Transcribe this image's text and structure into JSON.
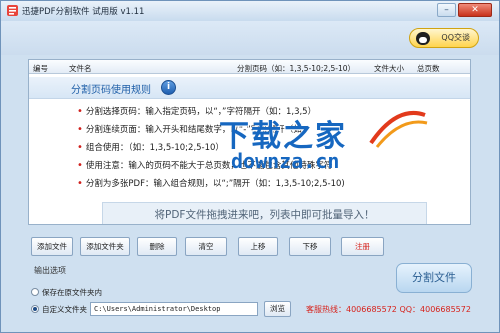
{
  "window": {
    "title": "迅捷PDF分割软件 试用版 v1.11",
    "min_glyph": "–",
    "close_glyph": "✕",
    "accent_color": "#1f5fa8"
  },
  "topbar": {
    "qq_label": "QQ交谈"
  },
  "columns": [
    "编号",
    "文件名",
    "分割页码（如：1,3,5-10;2,5-10）",
    "文件大小",
    "总页数"
  ],
  "rules": {
    "title": "分割页码使用规则",
    "info_glyph": "i",
    "items": [
      "分割选择页码：输入指定页码，以“，”字符隔开（如：1,3,5）",
      "分割连续页面：输入开头和结尾数字，以“-”字符隔开（如：",
      "组合使用：（如：1,3,5-10;2,5-10）",
      "使用注意：输入的页码不能大于总页数，也不能包含其他特殊字符",
      "分割为多张PDF：输入组合规则，以“;”隔开（如：1,3,5-10;2,5-10)"
    ]
  },
  "drop_hint": "将PDF文件拖拽进来吧，列表中即可批量导入！",
  "watermark": {
    "title": "下载之家",
    "domain": "downza.cn"
  },
  "buttons": {
    "add_file": "添加文件",
    "add_folder": "添加文件夹",
    "delete": "删除",
    "clear": "清空",
    "move_up": "上移",
    "move_down": "下移",
    "register": "注册"
  },
  "output": {
    "section_label": "输出选项",
    "option_original": "保存在原文件夹内",
    "option_custom": "自定义文件夹",
    "selected": "custom",
    "path_value": "C:\\Users\\Administrator\\Desktop",
    "browse_label": "浏览"
  },
  "split_button": "分割文件",
  "hotline": "客服热线：4006685572 QQ：4006685572"
}
